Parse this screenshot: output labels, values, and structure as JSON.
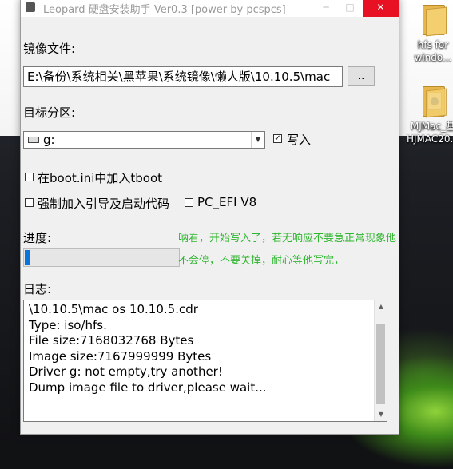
{
  "window": {
    "title": "Leopard 硬盘安装助手 Ver0.3 [power by pcspcs]",
    "minimize_glyph": "─",
    "maximize_glyph": "□",
    "close_glyph": "✕"
  },
  "image_file": {
    "label": "镜像文件:",
    "value": "E:\\备份\\系统相关\\黑苹果\\系统镜像\\懒人版\\10.10.5\\mac",
    "browse_label": ".."
  },
  "target": {
    "label": "目标分区:",
    "selected": "g:",
    "write_label": "写入",
    "write_checked": "✓"
  },
  "options": {
    "boot_ini_label": "在boot.ini中加入tboot",
    "force_boot_label": "强制加入引导及启动代码",
    "pc_efi_label": "PC_EFI V8"
  },
  "progress": {
    "label": "进度:",
    "fraction": 0.016,
    "note": "呐看，开始写入了，若无响应不要急正常现象他不会停，不要关掉，耐心等他写完，"
  },
  "log": {
    "label": "日志:",
    "lines": [
      "\\10.10.5\\mac os 10.10.5.cdr",
      "Type: iso/hfs.",
      "File size:7168032768 Bytes",
      "Image size:7167999999 Bytes",
      "Driver g: not empty,try another!",
      "Dump image file to driver,please wait..."
    ]
  },
  "desktop": {
    "icons": [
      {
        "label_line1": "hfs for",
        "label_line2": "windo..."
      },
      {
        "label_line1": "MJMac_基",
        "label_line2": "HJMAC20..."
      }
    ]
  },
  "colors": {
    "note_green": "#2fb62f",
    "progress_blue": "#0a74da",
    "close_red": "#e81123"
  }
}
